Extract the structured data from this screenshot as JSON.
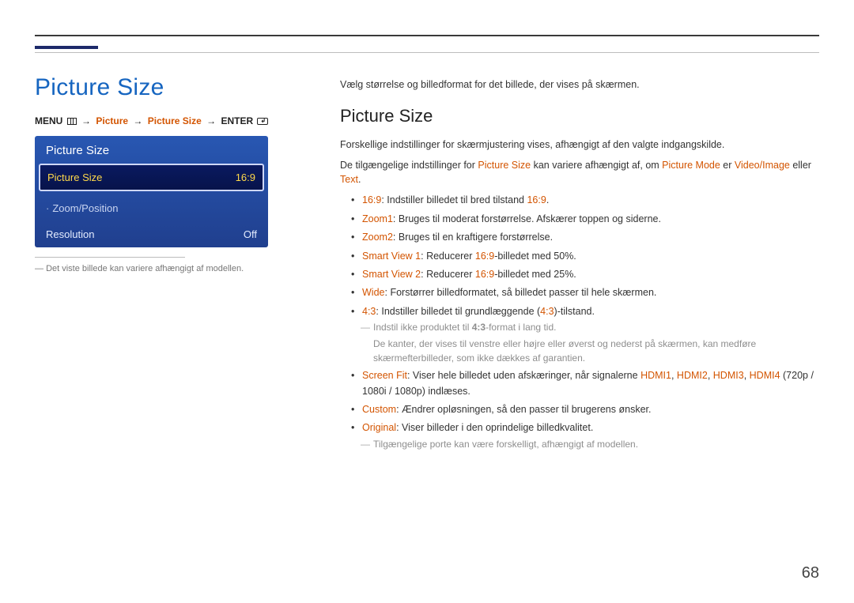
{
  "page_number": "68",
  "left": {
    "main_title": "Picture Size",
    "breadcrumb": {
      "menu": "MENU",
      "p1": "Picture",
      "p2": "Picture Size",
      "enter": "ENTER"
    },
    "osd": {
      "title": "Picture Size",
      "selected_label": "Picture Size",
      "selected_value": "16:9",
      "item2": "Zoom/Position",
      "item3_label": "Resolution",
      "item3_value": "Off"
    },
    "caption": "Det viste billede kan variere afhængigt af modellen."
  },
  "right": {
    "intro": "Vælg størrelse og billedformat for det billede, der vises på skærmen.",
    "sub_title": "Picture Size",
    "p1": "Forskellige indstillinger for skærmjustering vises, afhængigt af den valgte indgangskilde.",
    "p2_pre": "De tilgængelige indstillinger for ",
    "p2_ps": "Picture Size",
    "p2_mid": " kan variere afhængigt af, om ",
    "p2_pm": "Picture Mode",
    "p2_er": " er ",
    "p2_vi": "Video/Image",
    "p2_or": " eller ",
    "p2_tx": "Text",
    "p2_end": ".",
    "opts": [
      {
        "key": "16:9",
        "sep": ": ",
        "txt_a": "Indstiller billedet til bred tilstand ",
        "key_b": "16:9",
        "txt_b": "."
      },
      {
        "key": "Zoom1",
        "sep": ": ",
        "txt_a": "Bruges til moderat forstørrelse. Afskærer toppen og siderne."
      },
      {
        "key": "Zoom2",
        "sep": ": ",
        "txt_a": "Bruges til en kraftigere forstørrelse."
      },
      {
        "key": "Smart View 1",
        "sep": ": ",
        "txt_a": "Reducerer ",
        "key_b": "16:9",
        "txt_b": "-billedet med 50%."
      },
      {
        "key": "Smart View 2",
        "sep": ": ",
        "txt_a": "Reducerer ",
        "key_b": "16:9",
        "txt_b": "-billedet med 25%."
      },
      {
        "key": "Wide",
        "sep": ": ",
        "txt_a": "Forstørrer billedformatet, så billedet passer til hele skærmen."
      },
      {
        "key": "4:3",
        "sep": ": ",
        "txt_a": "Indstiller billedet til grundlæggende (",
        "key_b": "4:3",
        "txt_b": ")-tilstand."
      }
    ],
    "note43_a": "Indstil ikke produktet til ",
    "note43_key": "4:3",
    "note43_b": "-format i lang tid.",
    "note43_sub": "De kanter, der vises til venstre eller højre eller øverst og nederst på skærmen, kan medføre skærmefterbilleder, som ikke dækkes af garantien.",
    "screenfit": {
      "key": "Screen Fit",
      "txt1": ": Viser hele billedet uden afskæringer, når signalerne ",
      "h1": "HDMI1",
      "c1": ", ",
      "h2": "HDMI2",
      "c2": ", ",
      "h3": "HDMI3",
      "c3": ", ",
      "h4": "HDMI4",
      "txt2": " (720p / 1080i / 1080p) indlæses."
    },
    "custom": {
      "key": "Custom",
      "txt": ": Ændrer opløsningen, så den passer til brugerens ønsker."
    },
    "original": {
      "key": "Original",
      "txt": ": Viser billeder i den oprindelige billedkvalitet."
    },
    "note_ports": "Tilgængelige porte kan være forskelligt, afhængigt af modellen."
  }
}
